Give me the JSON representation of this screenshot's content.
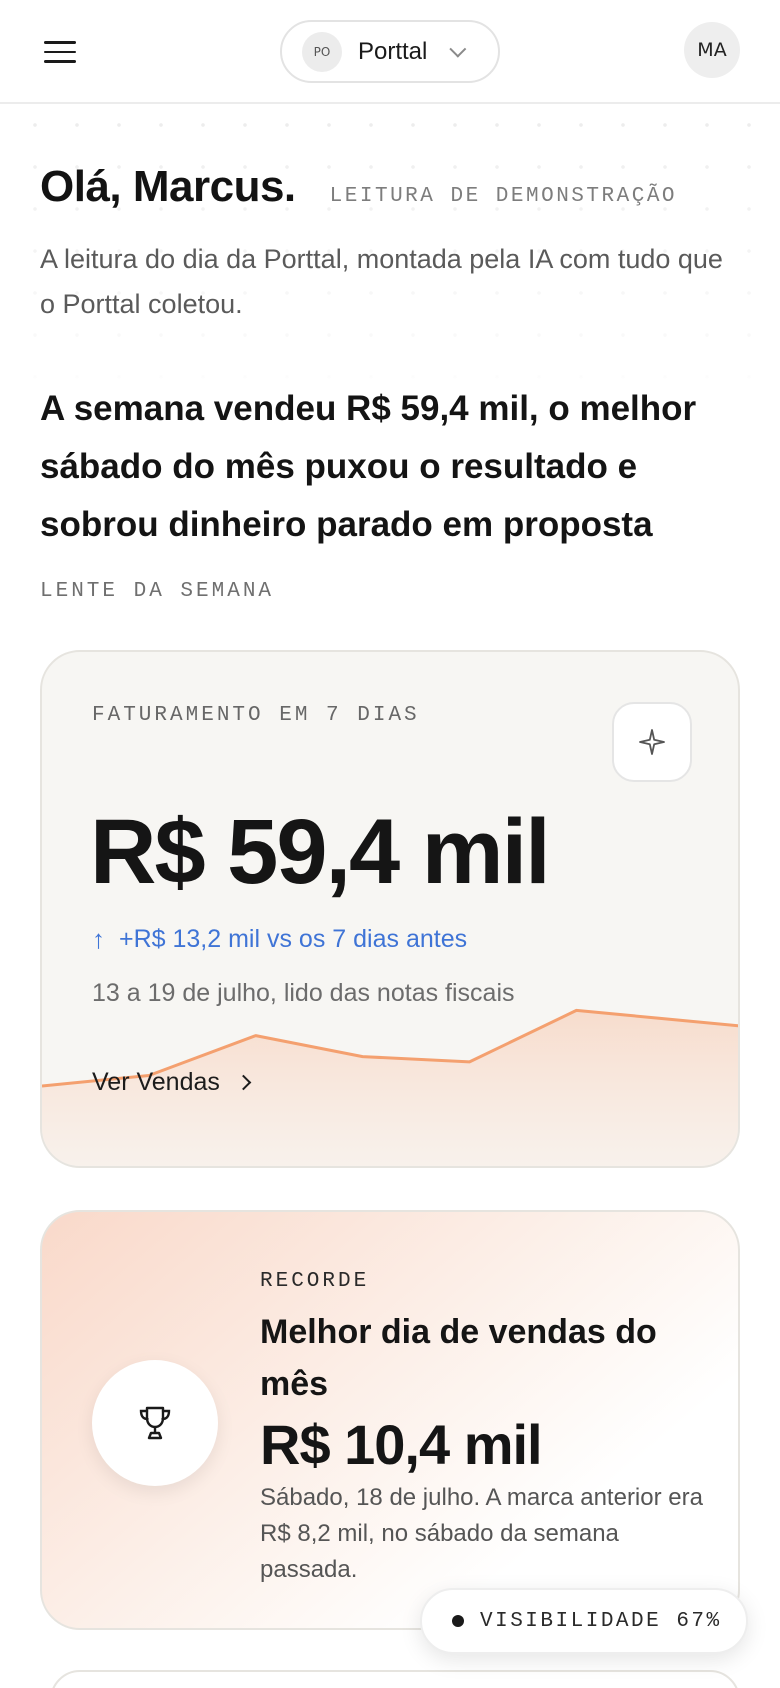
{
  "header": {
    "org_initials": "PO",
    "org_name": "Porttal",
    "user_initials": "MA"
  },
  "greeting": {
    "title": "Olá, Marcus.",
    "tag": "LEITURA DE DEMONSTRAÇÃO",
    "intro": "A leitura do dia da Porttal, montada pela IA com tudo que o Porttal coletou."
  },
  "headline": {
    "text": "A semana vendeu R$ 59,4 mil, o melhor sábado do mês puxou o resultado e sobrou dinheiro parado em proposta",
    "label": "LENTE DA SEMANA"
  },
  "revenue_card": {
    "label": "FATURAMENTO EM 7 DIAS",
    "value": "R$ 59,4 mil",
    "delta_arrow": "↑",
    "delta": "+R$ 13,2 mil vs os 7 dias antes",
    "period": "13 a 19 de julho, lido das notas fiscais",
    "link_label": "Ver Vendas",
    "sparkline": [
      20,
      30,
      68,
      48,
      43,
      92,
      77
    ],
    "sparkline_color": "#f4a06f"
  },
  "record_card": {
    "label": "RECORDE",
    "title": "Melhor dia de vendas do mês",
    "value": "R$ 10,4 mil",
    "description": "Sábado, 18 de julho. A marca anterior era R$ 8,2 mil, no sábado da semana passada."
  },
  "visibility": {
    "label": "VISIBILIDADE 67%"
  },
  "colors": {
    "accent_blue": "#3f74d6",
    "accent_orange": "#f4a06f"
  }
}
